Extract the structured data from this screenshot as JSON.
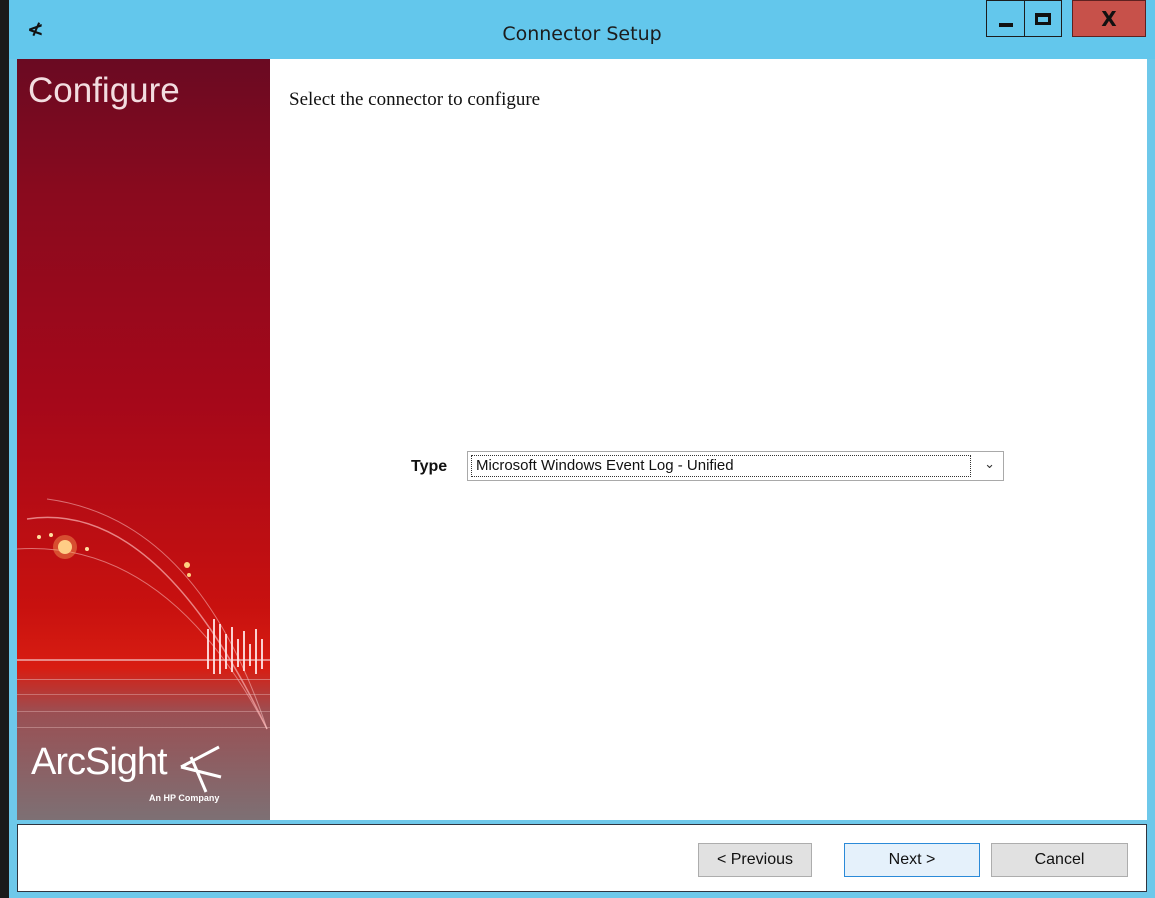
{
  "window": {
    "title": "Connector Setup",
    "icon": "arcsight-icon",
    "controls": {
      "minimize_icon": "minimize-icon",
      "maximize_icon": "maximize-icon",
      "close_label": "X"
    }
  },
  "sidebar": {
    "title": "Configure",
    "brand": "ArcSight",
    "tagline": "An HP Company"
  },
  "main": {
    "heading": "Select the connector to configure",
    "type_label": "Type",
    "type_value": "Microsoft Windows Event Log - Unified",
    "chevron": "⌄"
  },
  "footer": {
    "previous_label": "< Previous",
    "next_label": "Next >",
    "cancel_label": "Cancel"
  },
  "colors": {
    "titlebar": "#63c7ec",
    "close_button": "#c7514a",
    "next_button_border": "#2b8ad8",
    "sidebar_red": "#c8110f"
  }
}
